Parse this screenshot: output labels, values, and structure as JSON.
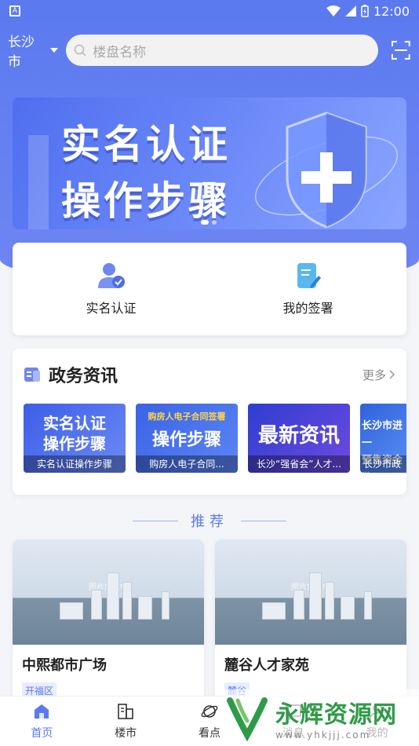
{
  "statusbar": {
    "app_badge": "A",
    "time": "12:00"
  },
  "header": {
    "city": "长沙市",
    "search_placeholder": "楼盘名称"
  },
  "banner": {
    "line1": "实名认证",
    "line2": "操作步骤"
  },
  "quick_actions": [
    {
      "label": "实名认证",
      "icon": "verified-user-icon"
    },
    {
      "label": "我的签署",
      "icon": "sign-document-icon"
    }
  ],
  "news": {
    "title": "政务资讯",
    "more": "更多",
    "items": [
      {
        "big": "实名认证\n操作步骤",
        "caption": "实名认证操作步骤"
      },
      {
        "big_prefix": "购房人电子合同签署",
        "big": "操作步骤",
        "caption": "购房人电子合同..."
      },
      {
        "big": "最新资讯",
        "caption": "长沙“强省会”人才..."
      },
      {
        "big": "长沙市进一\n预售资金监",
        "caption": "长沙市政"
      }
    ]
  },
  "recommend": {
    "title": "推荐"
  },
  "properties": [
    {
      "name": "中熙都市广场",
      "tag": "开福区",
      "img_placeholder": "图片加载中"
    },
    {
      "name": "麓谷人才家苑",
      "tag": "麓谷",
      "img_placeholder": "图片加载中"
    }
  ],
  "tabs": [
    {
      "label": "首页",
      "icon": "home-icon",
      "active": true
    },
    {
      "label": "楼市",
      "icon": "building-icon",
      "active": false
    },
    {
      "label": "看点",
      "icon": "planet-icon",
      "active": false
    },
    {
      "label": "消息",
      "icon": "message-icon",
      "active": false
    },
    {
      "label": "我的",
      "icon": "user-icon",
      "active": false
    }
  ],
  "watermark": {
    "name": "永辉资源网",
    "url": "www.yhkjjj.com"
  },
  "colors": {
    "primary": "#5b7af0",
    "watermark_green": "#2e9b48"
  }
}
